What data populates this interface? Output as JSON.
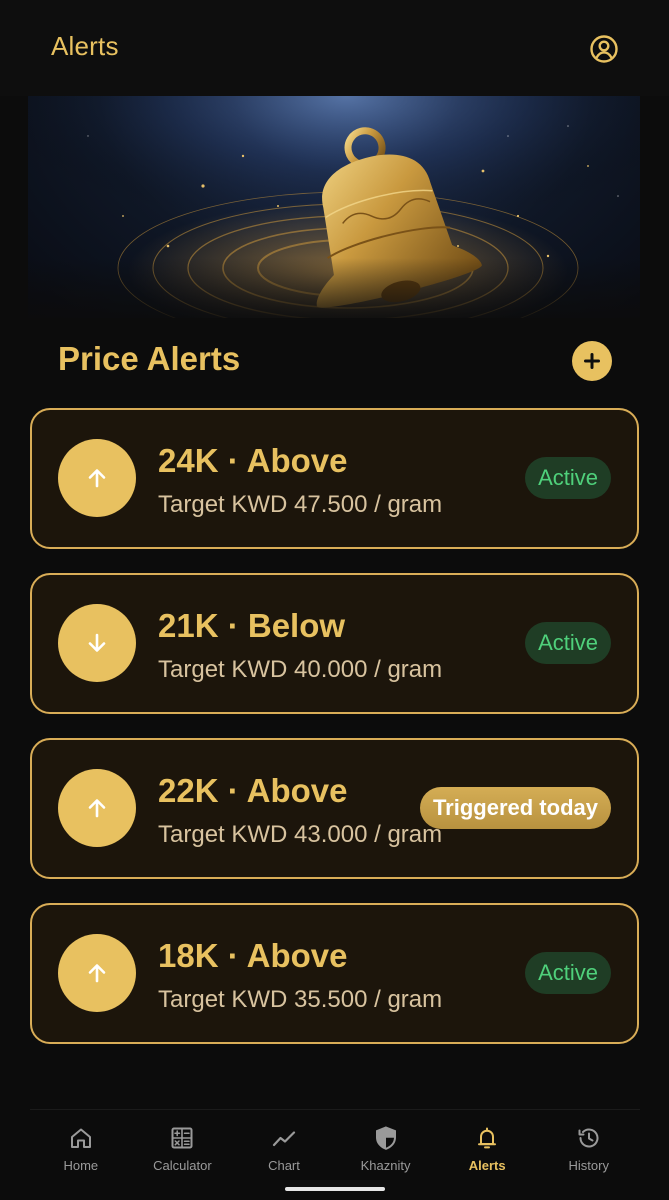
{
  "header": {
    "title": "Alerts",
    "account_icon": "account-circle-icon"
  },
  "hero": {
    "image": "golden-bell-illustration"
  },
  "section": {
    "title": "Price Alerts",
    "add_icon": "plus-icon"
  },
  "alerts": [
    {
      "title": "24K · Above",
      "target": "Target KWD 47.500 / gram",
      "direction": "up",
      "direction_icon": "arrow-up-icon",
      "status": "Active",
      "status_type": "active"
    },
    {
      "title": "21K · Below",
      "target": "Target KWD 40.000 / gram",
      "direction": "down",
      "direction_icon": "arrow-down-icon",
      "status": "Active",
      "status_type": "active"
    },
    {
      "title": "22K · Above",
      "target": "Target KWD 43.000 / gram",
      "direction": "up",
      "direction_icon": "arrow-up-icon",
      "status": "Triggered today",
      "status_type": "triggered"
    },
    {
      "title": "18K · Above",
      "target": "Target KWD 35.500 / gram",
      "direction": "up",
      "direction_icon": "arrow-up-icon",
      "status": "Active",
      "status_type": "active"
    }
  ],
  "nav": {
    "items": [
      {
        "label": "Home",
        "icon": "home-icon",
        "active": false
      },
      {
        "label": "Calculator",
        "icon": "calculator-icon",
        "active": false
      },
      {
        "label": "Chart",
        "icon": "chart-line-icon",
        "active": false
      },
      {
        "label": "Khaznity",
        "icon": "shield-icon",
        "active": false
      },
      {
        "label": "Alerts",
        "icon": "bell-icon",
        "active": true
      },
      {
        "label": "History",
        "icon": "history-icon",
        "active": false
      }
    ]
  },
  "colors": {
    "background": "#0c0c0c",
    "accent_gold": "#e8c160",
    "card_background": "#1c150b",
    "card_border": "#d9ad57",
    "active_badge_bg": "#1f3d25",
    "active_badge_text": "#4fd07b",
    "nav_inactive": "#9a9a9a"
  }
}
